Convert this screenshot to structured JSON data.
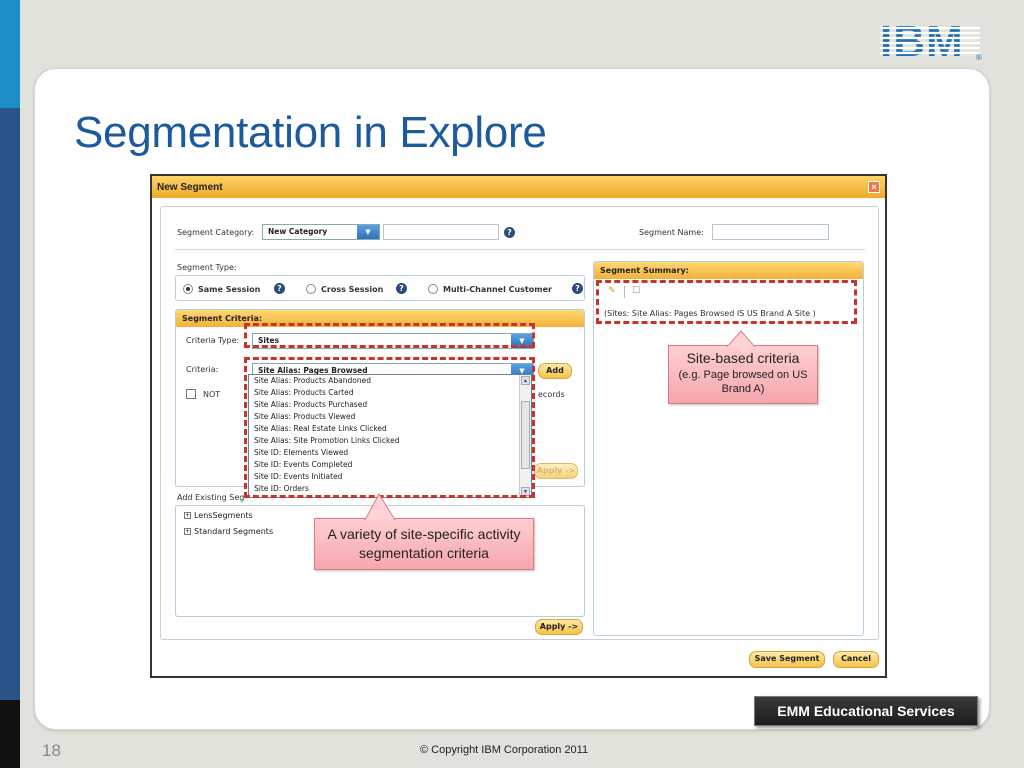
{
  "slide": {
    "title": "Segmentation in Explore",
    "number": "18",
    "copyright": "© Copyright IBM Corporation 2011",
    "badge": "EMM Educational Services",
    "logo": "IBM"
  },
  "dialog": {
    "title": "New Segment",
    "close": "×",
    "segment_category_label": "Segment Category:",
    "segment_category_value": "New Category",
    "segment_name_label": "Segment Name:",
    "segment_type_label": "Segment Type:",
    "types": [
      {
        "label": "Same Session",
        "selected": true
      },
      {
        "label": "Cross Session",
        "selected": false
      },
      {
        "label": "Multi-Channel Customer",
        "selected": false
      }
    ],
    "criteria_panel": {
      "title": "Segment Criteria:",
      "criteria_type_label": "Criteria Type:",
      "criteria_type_value": "Sites",
      "criteria_label": "Criteria:",
      "criteria_value": "Site Alias: Pages Browsed",
      "add_button": "Add",
      "not_label": "NOT",
      "records_label": "ecords",
      "apply_button": "Apply ->",
      "options": [
        "Site Alias: Products Abandoned",
        "Site Alias: Products Carted",
        "Site Alias: Products Purchased",
        "Site Alias: Products Viewed",
        "Site Alias: Real Estate Links Clicked",
        "Site Alias: Site Promotion Links Clicked",
        "Site ID: Elements Viewed",
        "Site ID: Events Completed",
        "Site ID: Events Initiated",
        "Site ID: Orders"
      ]
    },
    "existing_label": "Add Existing Seg",
    "existing_tree": [
      "LensSegments",
      "Standard Segments"
    ],
    "existing_apply_button": "Apply ->",
    "summary_panel": {
      "title": "Segment Summary:",
      "summary_text": "(Sites: Site Alias: Pages Browsed IS US Brand A Site )"
    },
    "save_button": "Save Segment",
    "cancel_button": "Cancel",
    "help_icon": "?"
  },
  "callouts": {
    "site_based": {
      "title": "Site-based criteria",
      "body": "(e.g. Page browsed on US Brand A)"
    },
    "variety": {
      "text": "A variety of site-specific activity segmentation criteria"
    }
  },
  "colors": {
    "title_blue": "#1b5b9d",
    "panel_header": "#f2b13a",
    "highlight_red": "#c9332e",
    "callout_pink": "#f4a7ad"
  }
}
